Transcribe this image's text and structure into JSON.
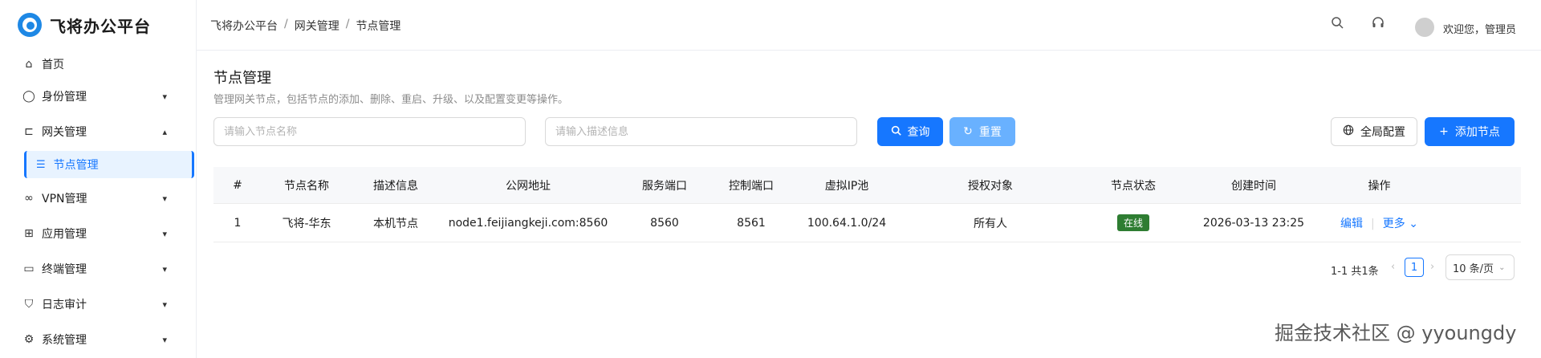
{
  "app": {
    "logo_text": "飞将办公平台"
  },
  "sidebar": {
    "items": [
      {
        "label": "首页",
        "icon": "home-icon"
      },
      {
        "label": "身份管理",
        "icon": "user-icon"
      },
      {
        "label": "网关管理",
        "icon": "gateway-icon"
      },
      {
        "label": "节点管理",
        "icon": "list-icon"
      },
      {
        "label": "VPN管理",
        "icon": "link-icon"
      },
      {
        "label": "应用管理",
        "icon": "apps-icon"
      },
      {
        "label": "终端管理",
        "icon": "laptop-icon"
      },
      {
        "label": "日志审计",
        "icon": "shield-icon"
      },
      {
        "label": "系统管理",
        "icon": "gear-icon"
      }
    ]
  },
  "header": {
    "breadcrumb": [
      "飞将办公平台",
      "网关管理",
      "节点管理"
    ],
    "breadcrumb_sep": "/",
    "welcome": "欢迎您，管理员"
  },
  "page": {
    "title": "节点管理",
    "description": "管理网关节点，包括节点的添加、删除、重启、升级、以及配置变更等操作。"
  },
  "search": {
    "name_placeholder": "请输入节点名称",
    "desc_placeholder": "请输入描述信息",
    "query_label": "查询",
    "reset_label": "重置",
    "global_config_label": "全局配置",
    "add_node_label": "添加节点"
  },
  "table": {
    "columns": [
      "#",
      "节点名称",
      "描述信息",
      "公网地址",
      "服务端口",
      "控制端口",
      "虚拟IP池",
      "授权对象",
      "节点状态",
      "创建时间",
      "操作"
    ],
    "rows": [
      {
        "index": "1",
        "name": "飞将-华东",
        "desc": "本机节点",
        "address": "node1.feijiangkeji.com:8560",
        "service_port": "8560",
        "control_port": "8561",
        "ip_pool": "100.64.1.0/24",
        "authorized": "所有人",
        "status": "在线",
        "created": "2026-03-13 23:25",
        "edit_label": "编辑",
        "more_label": "更多"
      }
    ]
  },
  "pagination": {
    "total_text": "1-1 共1条",
    "current_page": "1",
    "page_size": "10 条/页"
  },
  "colors": {
    "primary": "#1677ff",
    "status_online": "#2e7d32"
  },
  "watermark": "掘金技术社区 @ yyoungdy"
}
